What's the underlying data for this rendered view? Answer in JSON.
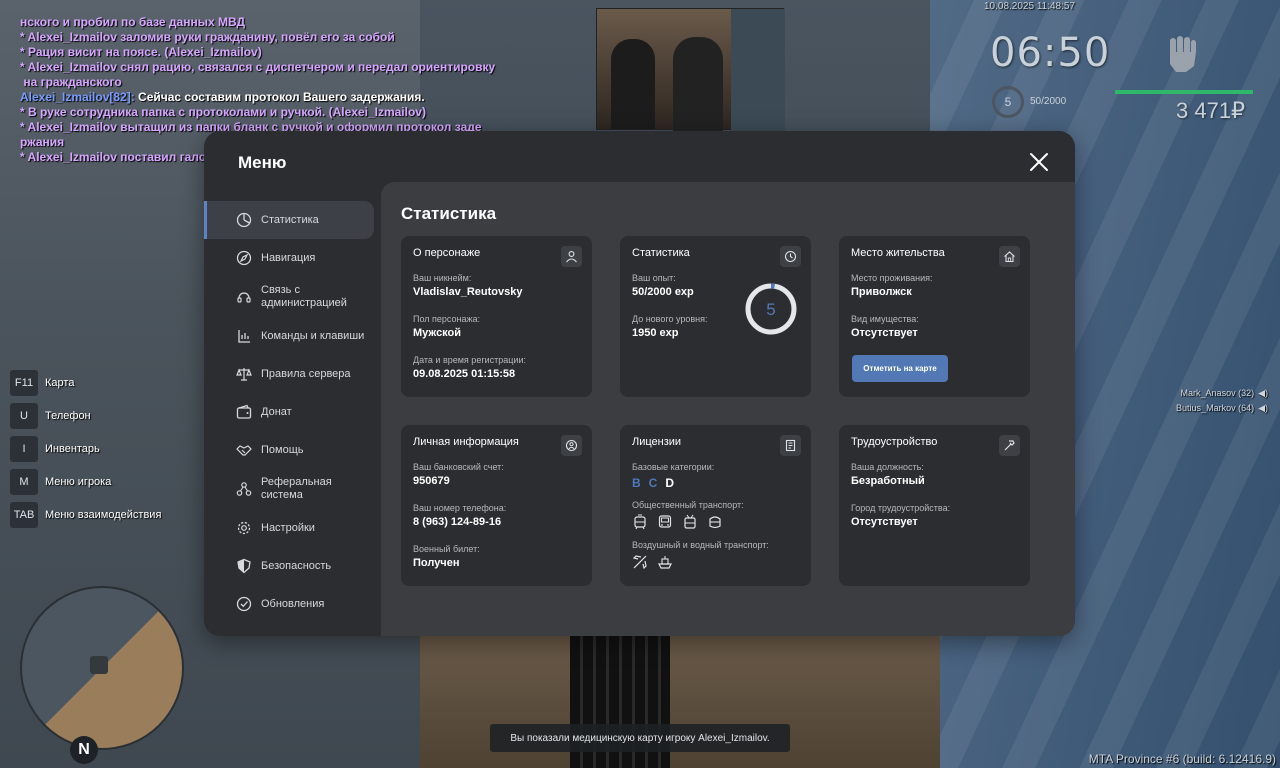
{
  "chat": {
    "lines": [
      {
        "type": "me",
        "text": "нского и пробил по базе данных МВД"
      },
      {
        "type": "me",
        "text": "* Alexei_Izmailov заломив руки гражданину, повёл его за собой"
      },
      {
        "type": "me",
        "text": "* Рация висит на поясе. (Alexei_Izmailov)"
      },
      {
        "type": "me",
        "text": "* Alexei_Izmailov снял рацию, связался с диспетчером и передал ориентировку"
      },
      {
        "type": "me",
        "text": " на гражданского"
      },
      {
        "type": "say",
        "name": "Alexei_Izmailov[82]:",
        "text": " Сейчас составим протокол Вашего задержания."
      },
      {
        "type": "me",
        "text": "* В руке сотрудника папка с протоколами и ручкой. (Alexei_Izmailov)"
      },
      {
        "type": "me",
        "text": "* Alexei_Izmailov вытащил из папки бланк с ручкой и оформил протокол заде"
      },
      {
        "type": "me",
        "text": "ржания"
      },
      {
        "type": "me",
        "text": "* Alexei_Izmailov поставил галочку об отказе"
      }
    ]
  },
  "hud": {
    "datetime": "10.08.2025 11:48:57",
    "time": "06:50",
    "level": "5",
    "exp": "50/2000",
    "money": "3 471₽"
  },
  "hotkeys": [
    {
      "key": "F11",
      "label": "Карта"
    },
    {
      "key": "U",
      "label": "Телефон"
    },
    {
      "key": "I",
      "label": "Инвентарь"
    },
    {
      "key": "M",
      "label": "Меню игрока"
    },
    {
      "key": "TAB",
      "label": "Меню взаимодействия"
    }
  ],
  "players": [
    {
      "name": "Mark_Anasov (32)"
    },
    {
      "name": "Butius_Markov (64)"
    }
  ],
  "notification": "Вы показали медицинскую карту игроку Alexei_Izmailov.",
  "build": "MTA Province #6 (build: 6.12416.9)",
  "radar": {
    "north": "N"
  },
  "menu": {
    "title": "Меню",
    "sidebar": [
      {
        "label": "Статистика",
        "icon": "pie-chart-icon",
        "active": true
      },
      {
        "label": "Навигация",
        "icon": "compass-icon"
      },
      {
        "label": "Связь с администрацией",
        "icon": "headset-icon"
      },
      {
        "label": "Команды и клавиши",
        "icon": "keyboard-icon"
      },
      {
        "label": "Правила сервера",
        "icon": "scales-icon"
      },
      {
        "label": "Донат",
        "icon": "wallet-icon"
      },
      {
        "label": "Помощь",
        "icon": "handshake-icon"
      },
      {
        "label": "Реферальная система",
        "icon": "referral-icon"
      },
      {
        "label": "Настройки",
        "icon": "gear-icon"
      },
      {
        "label": "Безопасность",
        "icon": "shield-icon"
      },
      {
        "label": "Обновления",
        "icon": "check-circle-icon"
      }
    ],
    "content_title": "Статистика",
    "cards": {
      "character": {
        "title": "О персонаже",
        "fields": [
          {
            "label": "Ваш никнейм:",
            "value": "Vladislav_Reutovsky"
          },
          {
            "label": "Пол персонажа:",
            "value": "Мужской"
          },
          {
            "label": "Дата и время регистрации:",
            "value": "09.08.2025 01:15:58"
          }
        ]
      },
      "stats": {
        "title": "Статистика",
        "fields": [
          {
            "label": "Ваш опыт:",
            "value": "50/2000 exp"
          },
          {
            "label": "До нового уровня:",
            "value": "1950 exp"
          }
        ],
        "level": "5",
        "progress": 0.025
      },
      "residence": {
        "title": "Место жительства",
        "fields": [
          {
            "label": "Место проживания:",
            "value": "Приволжск"
          },
          {
            "label": "Вид имущества:",
            "value": "Отсутствует"
          }
        ],
        "button": "Отметить на карте"
      },
      "personal": {
        "title": "Личная информация",
        "fields": [
          {
            "label": "Ваш банковский счет:",
            "value": "950679"
          },
          {
            "label": "Ваш номер телефона:",
            "value": "8 (963) 124-89-16"
          },
          {
            "label": "Военный билет:",
            "value": "Получен"
          }
        ]
      },
      "licenses": {
        "title": "Лицензии",
        "base_label": "Базовые категории:",
        "categories": [
          {
            "letter": "B",
            "color": "#4f78be"
          },
          {
            "letter": "C",
            "color": "#4f78be"
          },
          {
            "letter": "D",
            "color": "#ffffff"
          }
        ],
        "public_label": "Общественный транспорт:",
        "air_label": "Воздушный и водный транспорт:"
      },
      "employment": {
        "title": "Трудоустройство",
        "fields": [
          {
            "label": "Ваша должность:",
            "value": "Безработный"
          },
          {
            "label": "Город трудоустройства:",
            "value": "Отсутствует"
          }
        ]
      }
    }
  }
}
